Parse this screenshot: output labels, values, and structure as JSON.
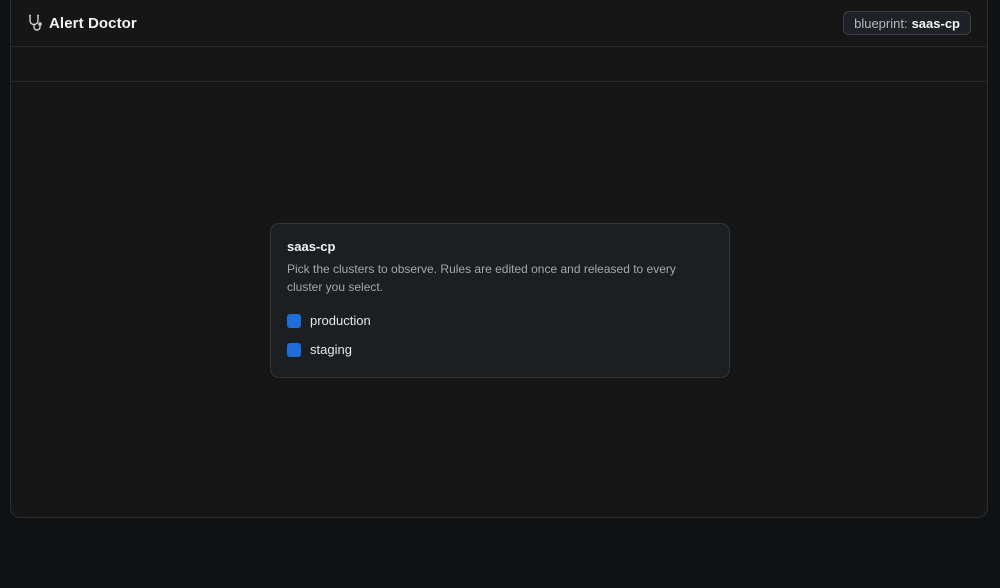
{
  "header": {
    "icon": "stethoscope-icon",
    "title": "Alert Doctor",
    "blueprint_key": "blueprint:",
    "blueprint_value": "saas-cp"
  },
  "card": {
    "title": "saas-cp",
    "description": "Pick the clusters to observe. Rules are edited once and released to every cluster you select.",
    "clusters": [
      {
        "label": "production",
        "checked": true
      },
      {
        "label": "staging",
        "checked": true
      }
    ]
  },
  "colors": {
    "page_background": "#0e1215",
    "window_background": "#161616",
    "card_background": "#1b1f21",
    "accent": "#1f6ddb"
  }
}
